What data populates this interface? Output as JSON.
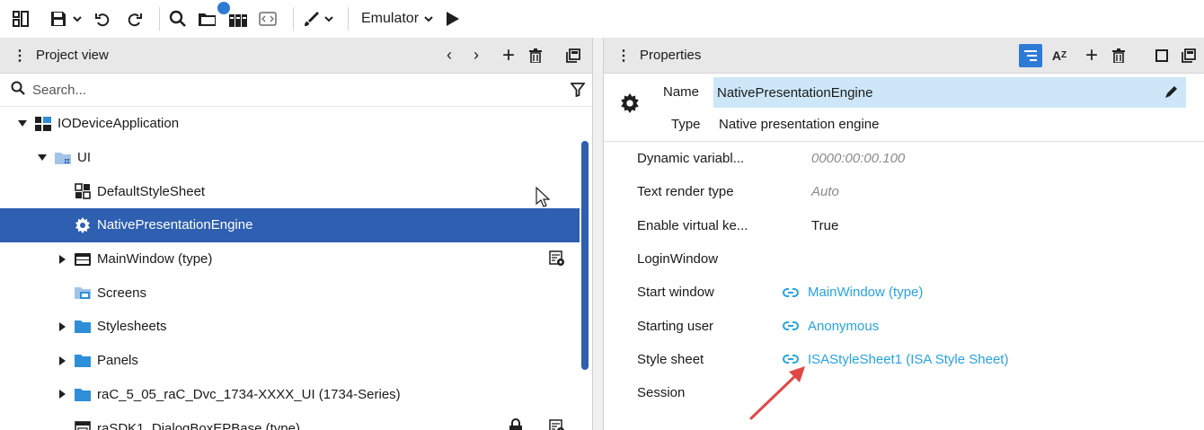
{
  "toolbar": {
    "emulator_label": "Emulator",
    "icons": [
      "layout-icon",
      "save-icon",
      "undo-icon",
      "redo-icon",
      "search-icon",
      "folder-icon",
      "library-icon",
      "code-icon",
      "brush-icon",
      "play-icon"
    ]
  },
  "project_view": {
    "title": "Project view",
    "search_placeholder": "Search...",
    "tree": [
      {
        "label": "IODeviceApplication",
        "icon": "application-icon",
        "level": 0,
        "caret": "expanded"
      },
      {
        "label": "UI",
        "icon": "ui-folder-icon",
        "level": 1,
        "caret": "expanded"
      },
      {
        "label": "DefaultStyleSheet",
        "icon": "stylesheet-icon",
        "level": 2,
        "caret": "none"
      },
      {
        "label": "NativePresentationEngine",
        "icon": "gear-icon",
        "level": 2,
        "caret": "none",
        "selected": true
      },
      {
        "label": "MainWindow (type)",
        "icon": "window-icon",
        "level": 2,
        "caret": "collapsed"
      },
      {
        "label": "Screens",
        "icon": "screens-icon",
        "level": 2,
        "caret": "none"
      },
      {
        "label": "Stylesheets",
        "icon": "folder-icon",
        "level": 2,
        "caret": "collapsed"
      },
      {
        "label": "Panels",
        "icon": "folder-icon",
        "level": 2,
        "caret": "collapsed"
      },
      {
        "label": "raC_5_05_raC_Dvc_1734-XXXX_UI (1734-Series)",
        "icon": "folder-icon",
        "level": 2,
        "caret": "collapsed"
      },
      {
        "label": "raSDK1_DialogBoxEPBase (type)",
        "icon": "dialog-icon",
        "level": 2,
        "caret": "none"
      }
    ]
  },
  "properties": {
    "title": "Properties",
    "name_label": "Name",
    "name_value": "NativePresentationEngine",
    "type_label": "Type",
    "type_value": "Native presentation engine",
    "rows": [
      {
        "label": "Dynamic variabl...",
        "value": "0000:00:00.100",
        "style": "muted"
      },
      {
        "label": "Text render type",
        "value": "Auto",
        "style": "muted"
      },
      {
        "label": "Enable virtual ke...",
        "value": "True",
        "style": "normal"
      },
      {
        "label": "LoginWindow",
        "value": "",
        "style": "normal"
      },
      {
        "label": "Start window",
        "value": "MainWindow (type)",
        "style": "link"
      },
      {
        "label": "Starting user",
        "value": "Anonymous",
        "style": "link"
      },
      {
        "label": "Style sheet",
        "value": "ISAStyleSheet1 (ISA Style Sheet)",
        "style": "link"
      },
      {
        "label": "Session",
        "value": "",
        "style": "normal"
      }
    ]
  },
  "colors": {
    "selection": "#2e5fb0",
    "link": "#27a3e0",
    "name_field": "#cde7f8",
    "annotation_arrow": "#e04848"
  }
}
